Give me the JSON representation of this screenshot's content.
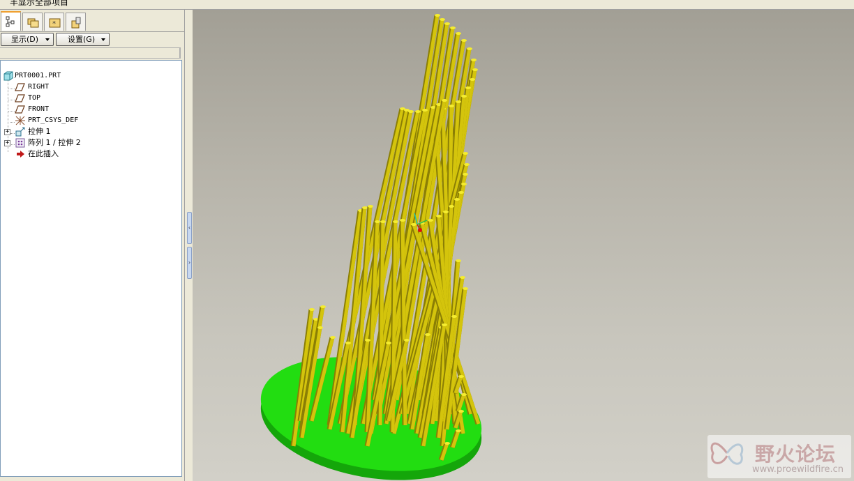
{
  "window": {
    "title_fragment": "丰显示全部项目"
  },
  "panel": {
    "tabs": [
      {
        "icon": "model-tree-icon",
        "active": true
      },
      {
        "icon": "folder-browser-icon",
        "active": false
      },
      {
        "icon": "favorites-icon",
        "active": false
      },
      {
        "icon": "connections-icon",
        "active": false
      }
    ],
    "display_button": "显示(D)",
    "settings_button": "设置(G)"
  },
  "tree": {
    "items": [
      {
        "label": "PRT0001.PRT",
        "icon": "part-icon"
      },
      {
        "label": "RIGHT",
        "icon": "datum-plane-icon"
      },
      {
        "label": "TOP",
        "icon": "datum-plane-icon"
      },
      {
        "label": "FRONT",
        "icon": "datum-plane-icon"
      },
      {
        "label": "PRT_CSYS_DEF",
        "icon": "coordinate-system-icon"
      },
      {
        "label": "拉伸 1",
        "icon": "extrude-icon",
        "expandable": true
      },
      {
        "label": "阵列 1 / 拉伸 2",
        "icon": "pattern-icon",
        "expandable": true
      },
      {
        "label": "在此插入",
        "icon": "insert-here-arrow-icon"
      }
    ]
  },
  "viewport": {
    "model": "rod-tower-on-elliptical-base",
    "colors": {
      "base": "#22dd11",
      "rods": "#d4c40c",
      "rod_tops": "#f4ec30"
    }
  },
  "watermark": {
    "title": "野火论坛",
    "url": "www.proewildfire.cn"
  }
}
